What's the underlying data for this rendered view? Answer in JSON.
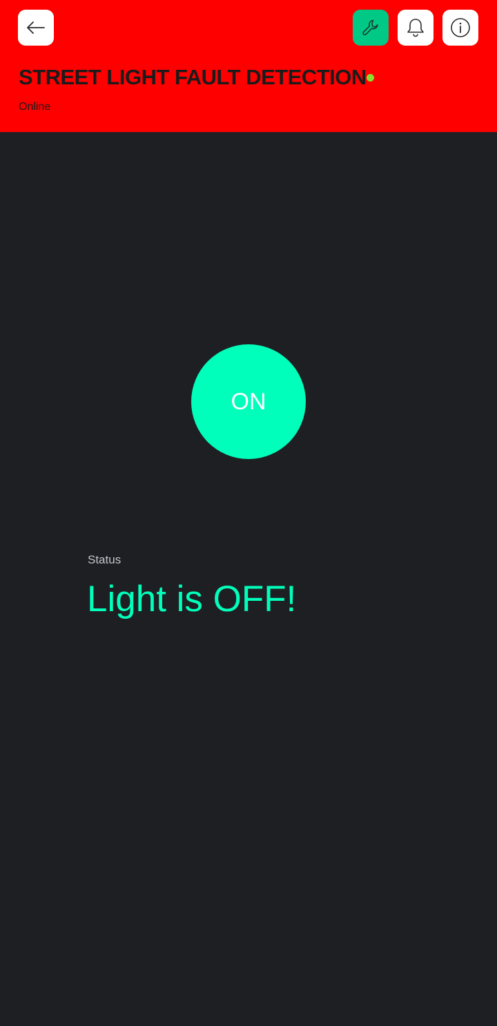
{
  "header": {
    "title": "STREET LIGHT FAULT DETECTION",
    "connection_status": "Online",
    "status_dot_color": "#86e02d",
    "background_color": "#ff0000",
    "buttons": {
      "back": "back-arrow-icon",
      "edit": "wrench-icon",
      "notifications": "bell-icon",
      "info": "info-icon"
    }
  },
  "main": {
    "power_button": {
      "label": "ON",
      "color": "#00ffbb"
    },
    "status_widget": {
      "label": "Status",
      "value": "Light is OFF!",
      "value_color": "#00ffbb"
    }
  }
}
